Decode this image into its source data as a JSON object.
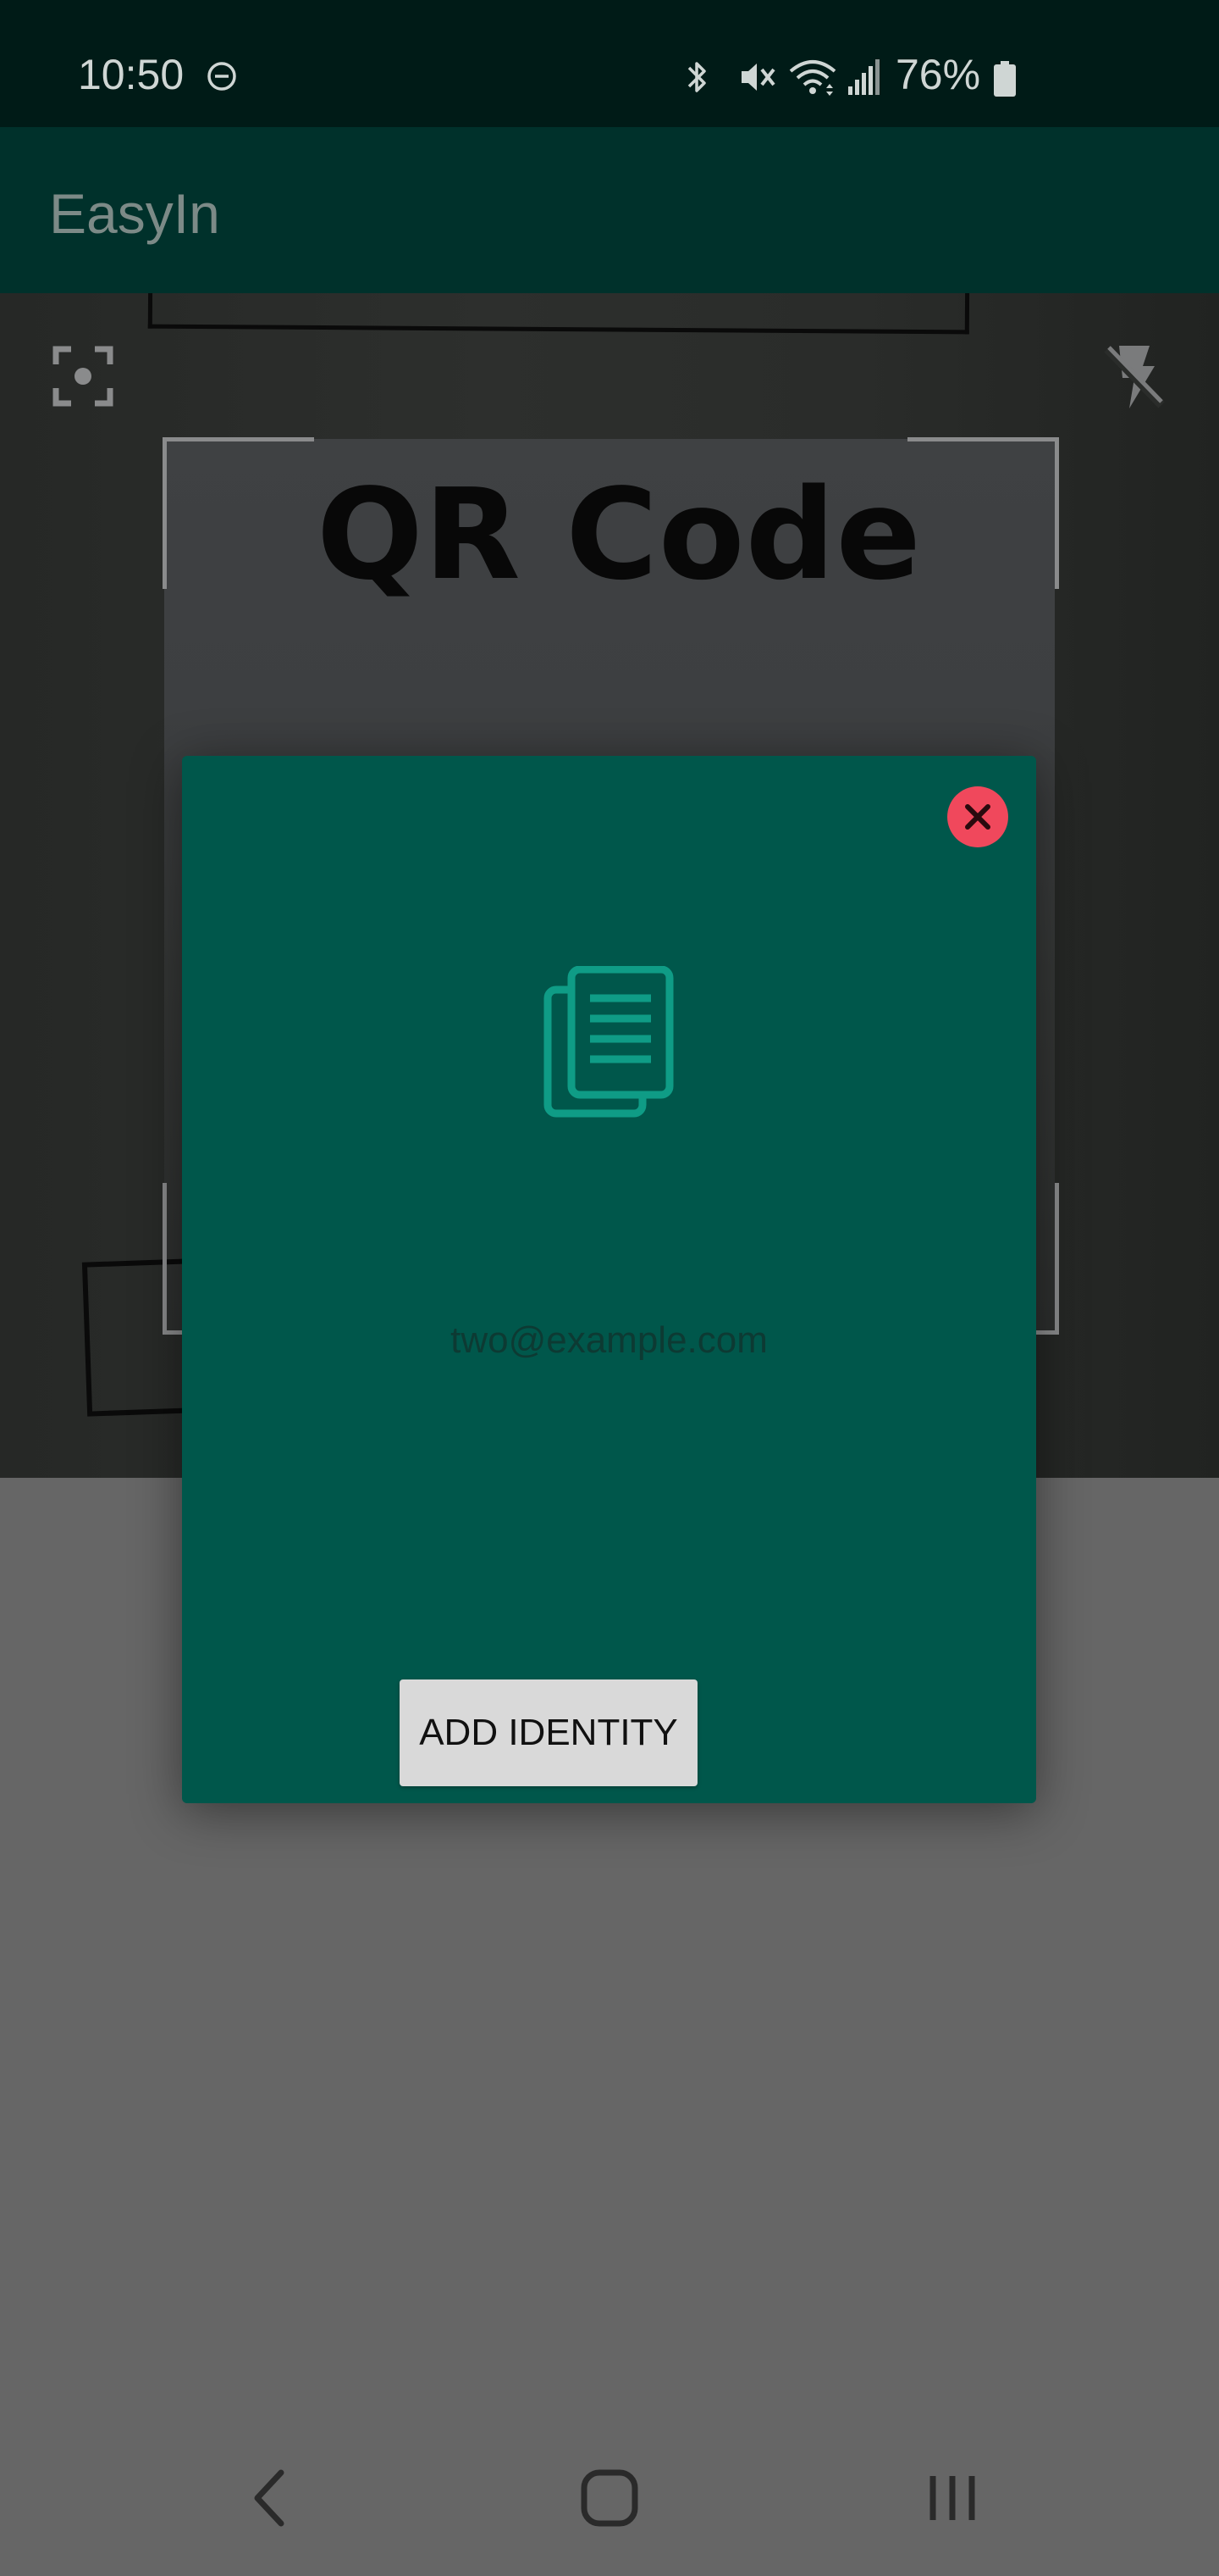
{
  "status_bar": {
    "time": "10:50",
    "battery_percent": "76%",
    "icons": [
      "dnd-icon",
      "bluetooth-icon",
      "vibrate-mute-icon",
      "wifi-icon",
      "signal-icon",
      "battery-icon"
    ]
  },
  "app_bar": {
    "title": "EasyIn"
  },
  "camera": {
    "visible_text": "QR Code",
    "icons": [
      "focus-icon",
      "flash-off-icon"
    ]
  },
  "dialog": {
    "email": "two@example.com",
    "add_button_label": "ADD IDENTITY",
    "icons": [
      "close-icon",
      "copy-documents-icon"
    ],
    "colors": {
      "background": "#00574b",
      "close_button": "#f0485c",
      "icon": "#0f9c86"
    }
  },
  "nav_bar": {
    "buttons": [
      "back-button",
      "home-button",
      "recents-button"
    ]
  },
  "colors": {
    "status_bar": "#001b17",
    "app_bar": "#00312b",
    "scrim": "#666666"
  }
}
